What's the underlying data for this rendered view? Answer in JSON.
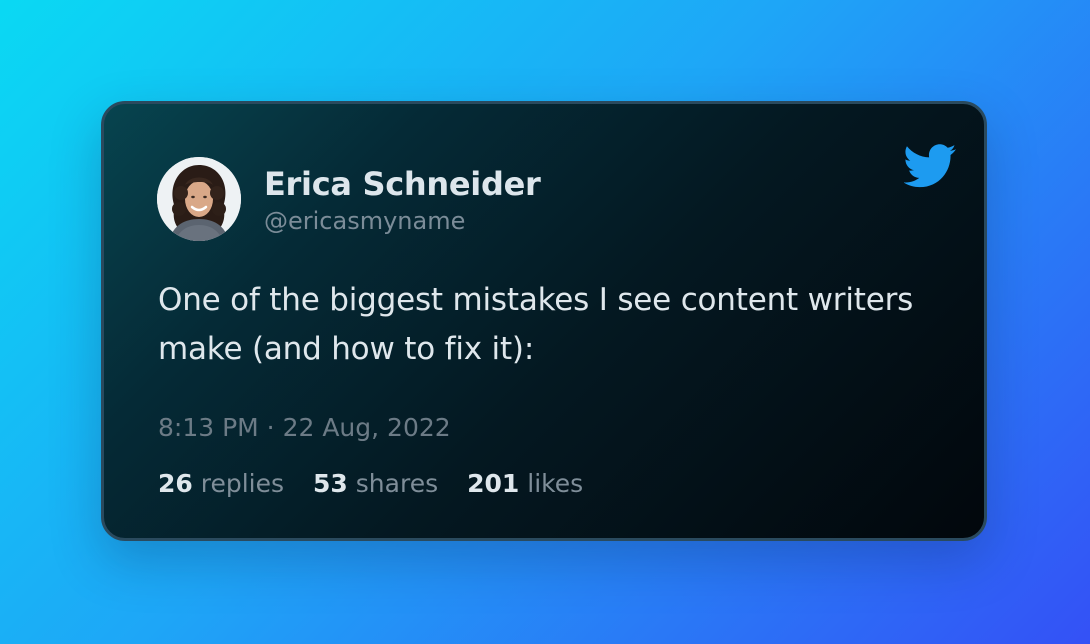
{
  "tweet": {
    "author_name": "Erica Schneider",
    "author_handle": "@ericasmyname",
    "text": "One of the biggest mistakes I see content writers make (and how to fix it):",
    "timestamp": "8:13 PM · 22 Aug, 2022",
    "stats": {
      "replies_count": "26",
      "replies_label": "replies",
      "shares_count": "53",
      "shares_label": "shares",
      "likes_count": "201",
      "likes_label": "likes"
    }
  },
  "icons": {
    "brand": "twitter-bird-icon",
    "brand_color": "#1d9bf0"
  },
  "colors": {
    "background_start": "#0ad9f3",
    "background_end": "#3451f6",
    "card_background": "#041821",
    "primary_text": "#dfe7ec",
    "secondary_text": "#7b8c98"
  }
}
